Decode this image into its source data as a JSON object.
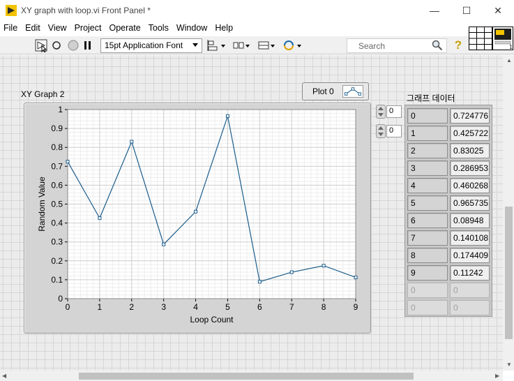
{
  "window": {
    "title": "XY graph with loop.vi Front Panel *"
  },
  "menu": [
    "File",
    "Edit",
    "View",
    "Project",
    "Operate",
    "Tools",
    "Window",
    "Help"
  ],
  "toolbar": {
    "font": "15pt Application Font",
    "search_placeholder": "Search",
    "help_label": "?"
  },
  "graph": {
    "label": "XY Graph 2",
    "legend": "Plot 0",
    "xlabel": "Loop Count",
    "ylabel": "Random Value"
  },
  "chart_data": {
    "type": "line",
    "x": [
      0,
      1,
      2,
      3,
      4,
      5,
      6,
      7,
      8,
      9
    ],
    "series": [
      {
        "name": "Plot 0",
        "values": [
          0.7248,
          0.4257,
          0.83025,
          0.287,
          0.4603,
          0.9657,
          0.0895,
          0.1401,
          0.1744,
          0.11242
        ]
      }
    ],
    "xlabel": "Loop Count",
    "ylabel": "Random Value",
    "xlim": [
      0,
      9
    ],
    "ylim": [
      0,
      1
    ],
    "xticks": [
      "0",
      "1",
      "2",
      "3",
      "4",
      "5",
      "6",
      "7",
      "8",
      "9"
    ],
    "yticks": [
      "0",
      "0.1",
      "0.2",
      "0.3",
      "0.4",
      "0.5",
      "0.6",
      "0.7",
      "0.8",
      "0.9",
      "1"
    ],
    "grid": true,
    "line_color": "#1a5c8c"
  },
  "array": {
    "label": "그래프 데이터",
    "index_row": "0",
    "index_col": "0",
    "rows": [
      [
        "0",
        "0.724776"
      ],
      [
        "1",
        "0.425722"
      ],
      [
        "2",
        "0.83025"
      ],
      [
        "3",
        "0.286953"
      ],
      [
        "4",
        "0.460268"
      ],
      [
        "5",
        "0.965735"
      ],
      [
        "6",
        "0.08948"
      ],
      [
        "7",
        "0.140108"
      ],
      [
        "8",
        "0.174409"
      ],
      [
        "9",
        "0.11242"
      ],
      [
        "0",
        "0"
      ],
      [
        "0",
        "0"
      ]
    ]
  },
  "colors": {
    "panel_bg": "#ececec",
    "grid_line": "#d6d6d6",
    "plot_line": "#1a5c8c"
  }
}
